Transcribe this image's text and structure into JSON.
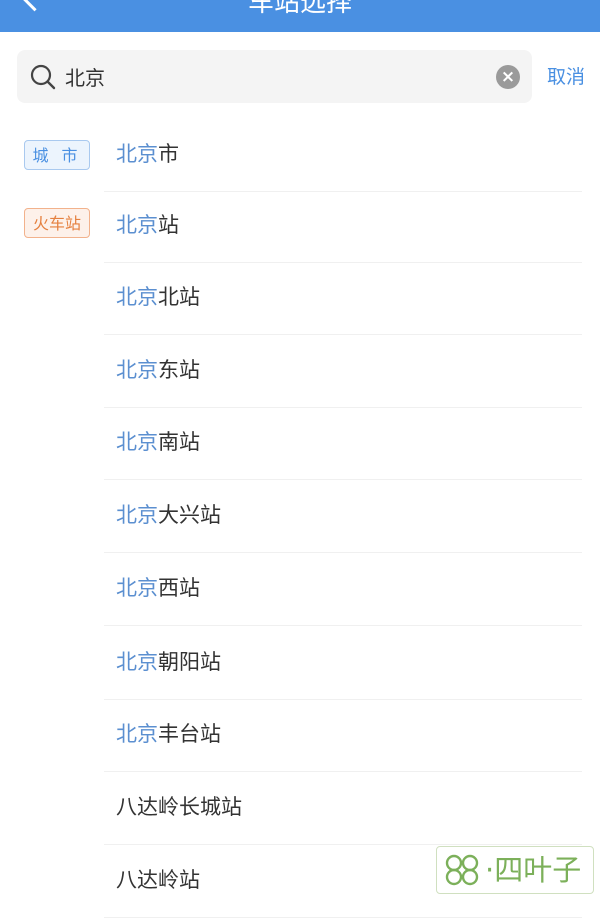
{
  "header": {
    "title": "车站选择",
    "back_icon": "back-arrow-icon"
  },
  "search": {
    "value": "北京",
    "placeholder": "",
    "icon": "search-icon",
    "clear_icon": "clear-icon"
  },
  "cancel_label": "取消",
  "tags": {
    "city": "城 市",
    "station": "火车站"
  },
  "results": [
    {
      "highlight": "北京",
      "rest": "市"
    },
    {
      "highlight": "北京",
      "rest": "站"
    },
    {
      "highlight": "北京",
      "rest": "北站"
    },
    {
      "highlight": "北京",
      "rest": "东站"
    },
    {
      "highlight": "北京",
      "rest": "南站"
    },
    {
      "highlight": "北京",
      "rest": "大兴站"
    },
    {
      "highlight": "北京",
      "rest": "西站"
    },
    {
      "highlight": "北京",
      "rest": "朝阳站"
    },
    {
      "highlight": "北京",
      "rest": "丰台站"
    },
    {
      "highlight": "",
      "rest": "八达岭长城站"
    },
    {
      "highlight": "",
      "rest": "八达岭站"
    }
  ],
  "watermark": {
    "text": "·四叶子",
    "icon": "clover-logo-icon"
  },
  "colors": {
    "accent": "#4a90e2",
    "highlight": "#5b8fd0",
    "tag_orange": "#e5803f"
  }
}
